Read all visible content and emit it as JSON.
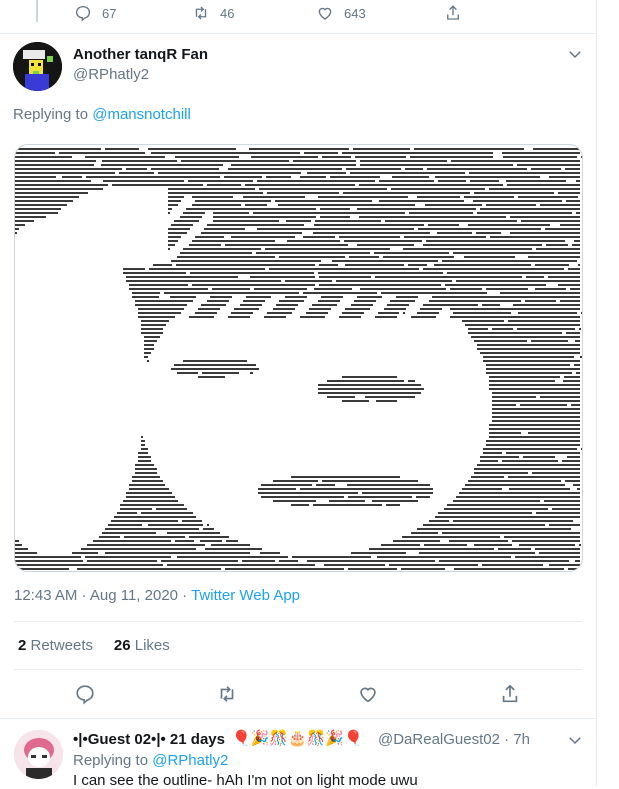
{
  "previous_tweet": {
    "reply_count": "67",
    "retweet_count": "46",
    "like_count": "643"
  },
  "tweet": {
    "display_name": "Another tanqR Fan",
    "handle": "@RPhatly2",
    "replying_prefix": "Replying to ",
    "replying_to": "@mansnotchill",
    "timestamp": "12:43 AM · Aug 11, 2020 · ",
    "source": "Twitter Web App",
    "retweets_count": "2",
    "retweets_label": " Retweets",
    "likes_count": "26",
    "likes_label": " Likes",
    "image_description": "ASCII-style horizontal line art portrait of an anime character"
  },
  "reply": {
    "display_name": "•|•Guest 02•|• 21 days",
    "emoji": "🎈🎉🎊🎂🎊🎉🎈",
    "handle_time": "@DaRealGuest02 · 7h",
    "replying_prefix": "Replying to ",
    "replying_to": "@RPhatly2",
    "text": "I can see the outline- hAh I'm not on light mode uwu"
  },
  "colors": {
    "accent": "#1da1f2",
    "secondary_text": "#657786",
    "primary_text": "#14171a",
    "divider": "#e6ecf0"
  },
  "icons": {
    "reply": "reply-icon",
    "retweet": "retweet-icon",
    "like": "heart-icon",
    "share": "share-icon",
    "more": "chevron-down-icon"
  }
}
